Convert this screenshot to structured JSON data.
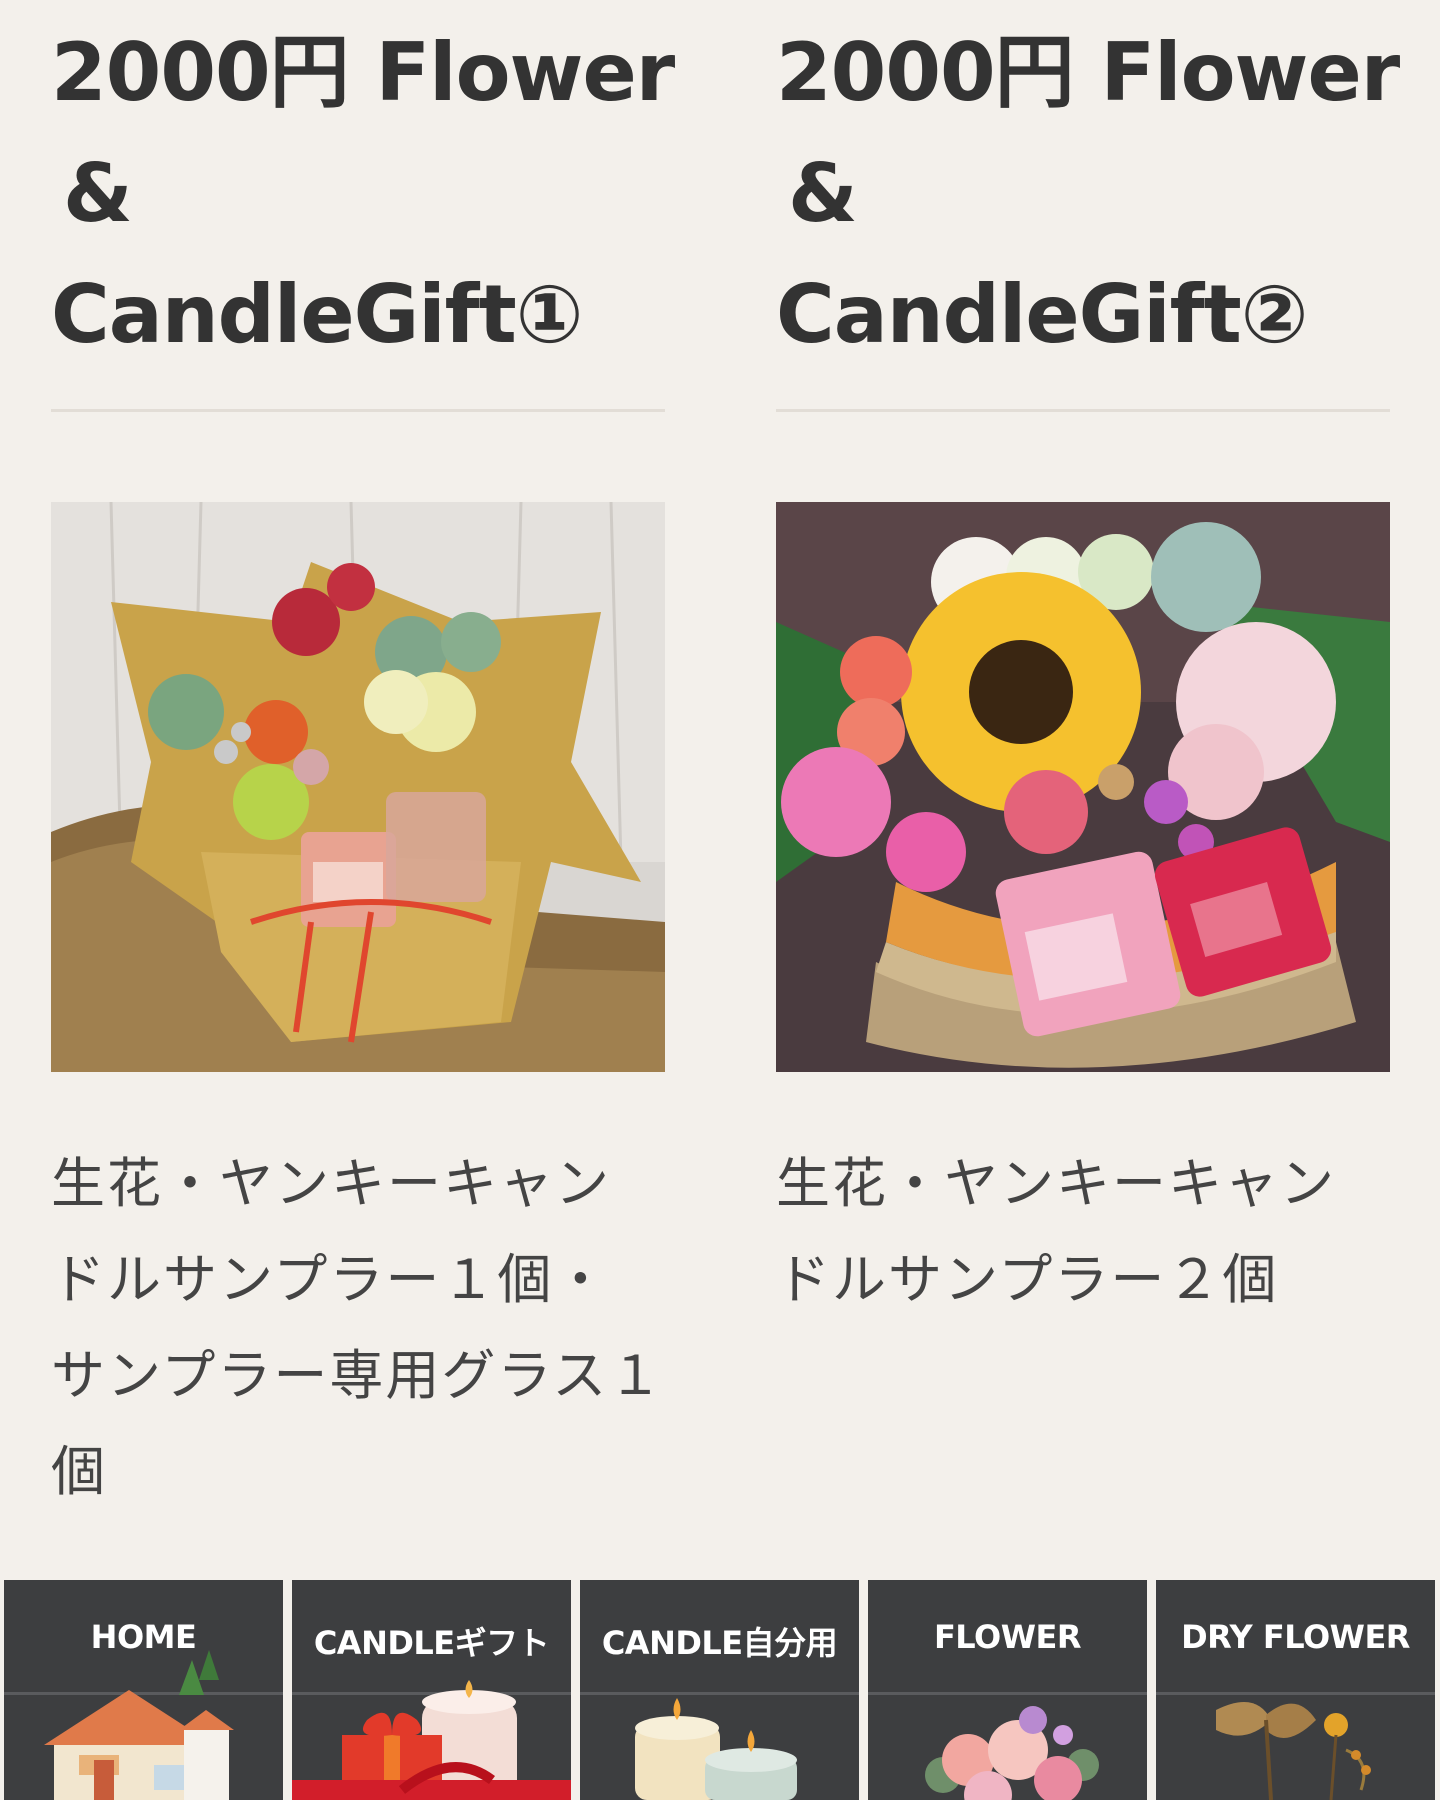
{
  "products": [
    {
      "title_lines": [
        "2000円 Flower",
        "&",
        "CandleGift①"
      ],
      "description_lines": [
        "生花・ヤンキーキャン",
        "ドルサンプラー１個・",
        "サンプラー専用グラス１",
        "個"
      ],
      "image": "flower-bouquet-with-candle-sampler-and-glass"
    },
    {
      "title_lines": [
        "2000円 Flower",
        "&",
        "CandleGift②"
      ],
      "description_lines": [
        "生花・ヤンキーキャン",
        "ドルサンプラー２個"
      ],
      "image": "sunflower-basket-with-two-candle-samplers"
    }
  ],
  "nav": [
    {
      "label": "HOME",
      "icon": "house-icon"
    },
    {
      "label": "CANDLEギフト",
      "icon": "gift-candle-icon"
    },
    {
      "label": "CANDLE自分用",
      "icon": "candle-jar-icon"
    },
    {
      "label": "FLOWER",
      "icon": "rose-bouquet-icon"
    },
    {
      "label": "DRY FLOWER",
      "icon": "dried-flower-icon"
    }
  ],
  "colors": {
    "background": "#f3f0eb",
    "text": "#333333",
    "nav_background": "#3d3e40",
    "nav_text": "#ffffff"
  }
}
